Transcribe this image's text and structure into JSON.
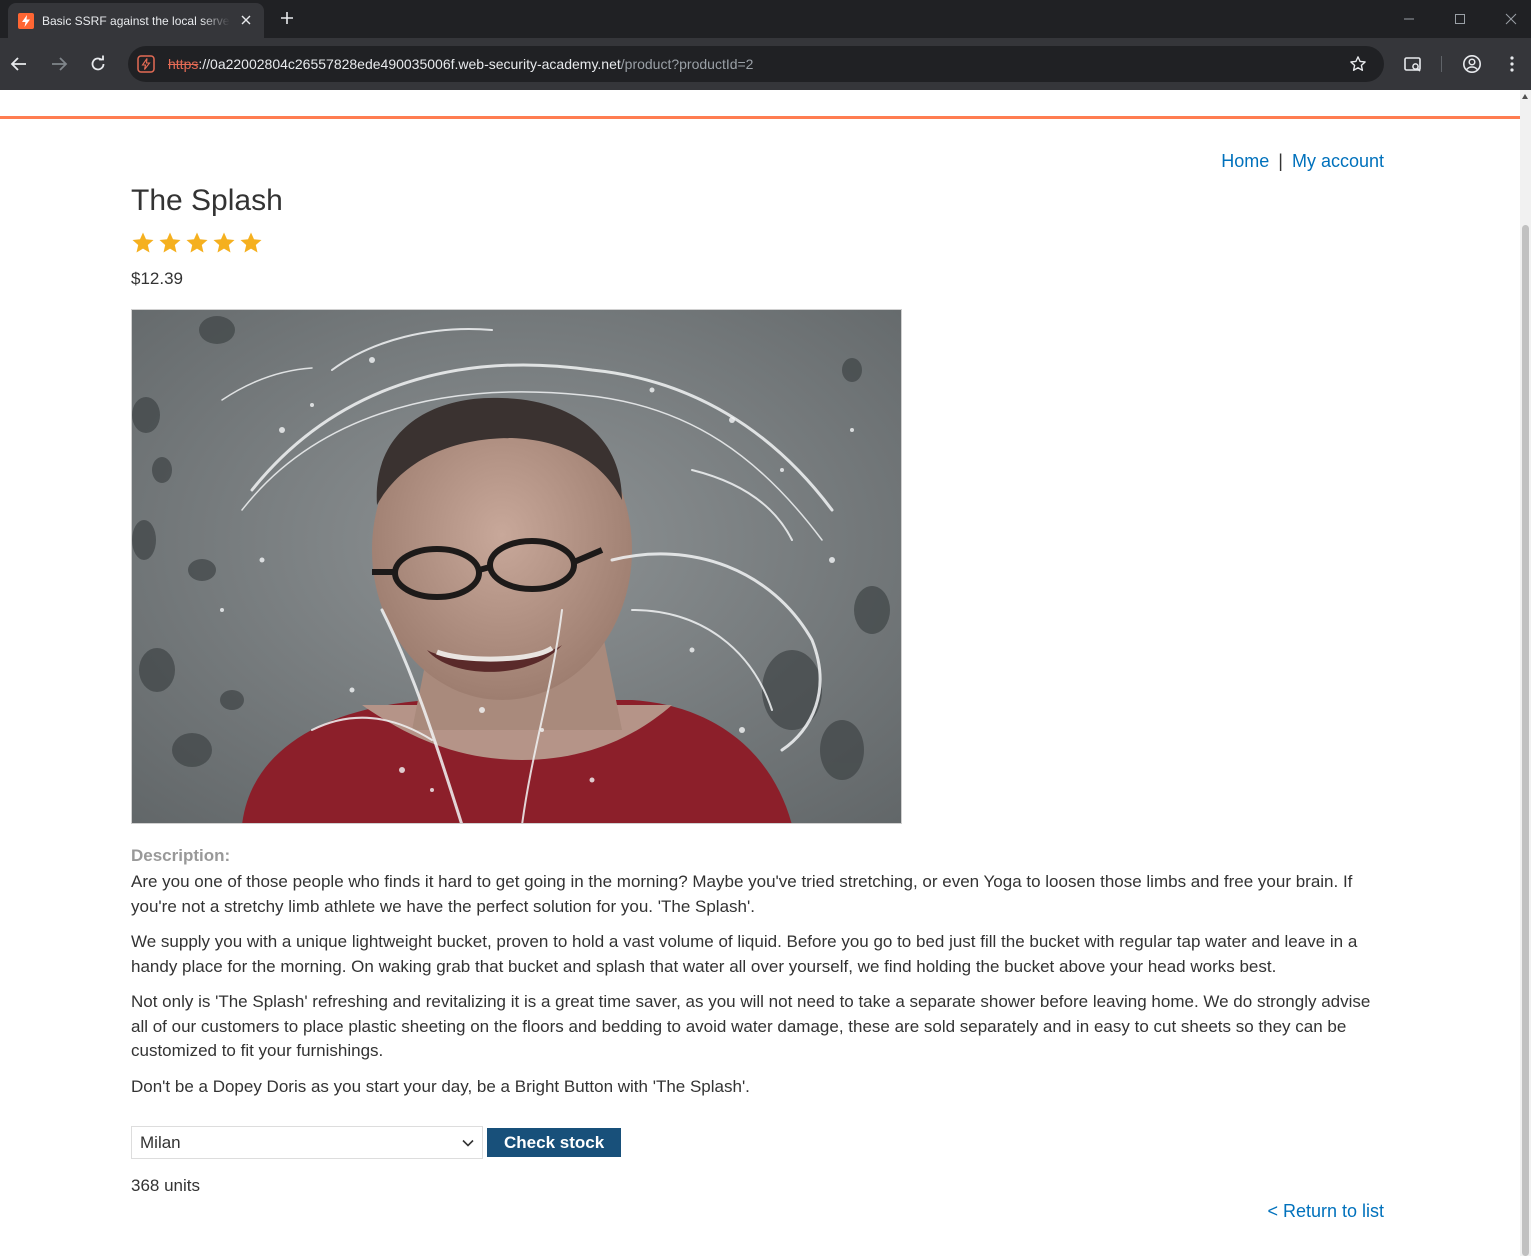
{
  "browser": {
    "tab_title": "Basic SSRF against the local server",
    "url_scheme": "https",
    "url_host": "://0a22002804c26557828ede490035006f.web-security-academy.net",
    "url_path": "/product?productId=2"
  },
  "nav": {
    "home": "Home",
    "separator": "|",
    "my_account": "My account"
  },
  "product": {
    "title": "The Splash",
    "rating": 5,
    "price": "$12.39",
    "description_label": "Description:",
    "description": [
      "Are you one of those people who finds it hard to get going in the morning? Maybe you've tried stretching, or even Yoga to loosen those limbs and free your brain. If you're not a stretchy limb athlete we have the perfect solution for you. 'The Splash'.",
      "We supply you with a unique lightweight bucket, proven to hold a vast volume of liquid. Before you go to bed just fill the bucket with regular tap water and leave in a handy place for the morning. On waking grab that bucket and splash that water all over yourself, we find holding the bucket above your head works best.",
      "Not only is 'The Splash' refreshing and revitalizing it is a great time saver, as you will not need to take a separate shower before leaving home. We do strongly advise all of our customers to place plastic sheeting on the floors and bedding to avoid water damage, these are sold separately and in easy to cut sheets so they can be customized to fit your furnishings.",
      "Don't be a Dopey Doris as you start your day, be a Bright Button with 'The Splash'."
    ]
  },
  "stock": {
    "selected_store": "Milan",
    "check_button": "Check stock",
    "result": "368 units"
  },
  "footer": {
    "return_link": "< Return to list"
  },
  "colors": {
    "accent_orange": "#ff6633",
    "link_blue": "#0071bc",
    "button_blue": "#18507a",
    "star_gold": "#f5b01f"
  }
}
